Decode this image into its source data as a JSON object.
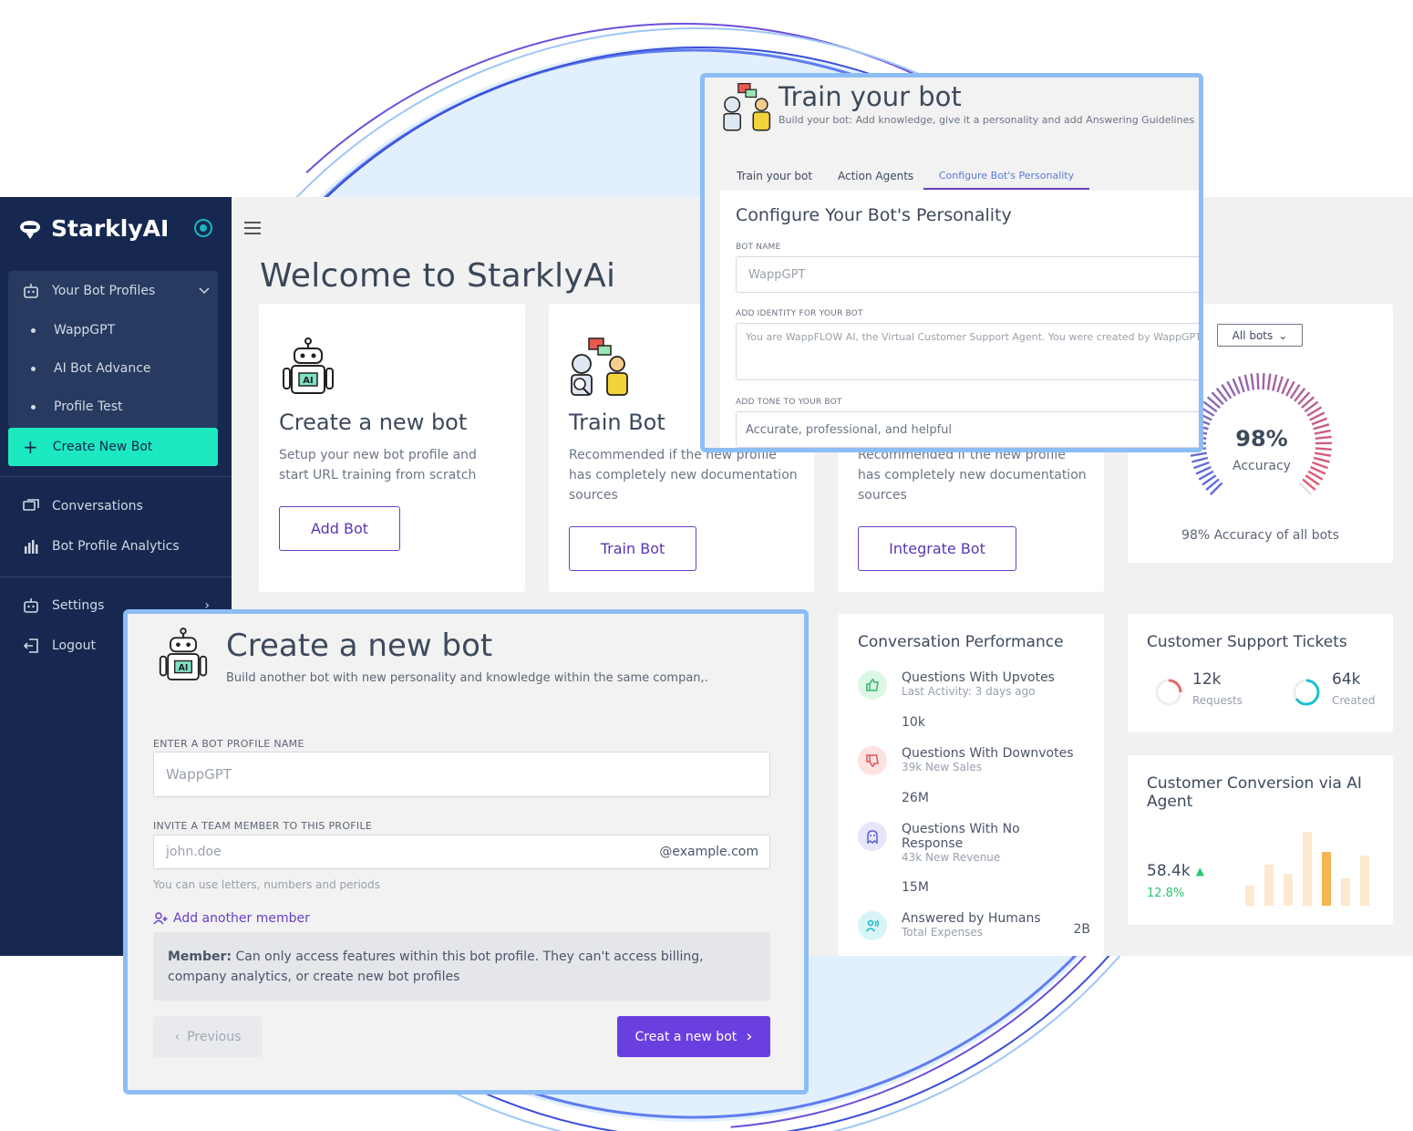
{
  "sidebar": {
    "brand": "StarklyAI",
    "group_label": "Your Bot Profiles",
    "bots": [
      "WappGPT",
      "AI Bot Advance",
      "Profile Test"
    ],
    "create_label": "Create New Bot",
    "nav": [
      "Conversations",
      "Bot Profile Analytics"
    ],
    "settings_label": "Settings",
    "logout_label": "Logout"
  },
  "main": {
    "welcome": "Welcome to StarklyAi",
    "cards": [
      {
        "title": "Create a new bot",
        "desc": "Setup your new bot profile and start URL training from scratch",
        "button": "Add Bot"
      },
      {
        "title": "Train Bot",
        "desc": "Recommended if the new profile has completely new documentation sources",
        "button": "Train Bot"
      },
      {
        "title": "",
        "desc": "Recommended if the new profile has completely new documentation sources",
        "button": "Integrate Bot"
      }
    ],
    "accuracy": {
      "filter": "All bots",
      "value_label": "98%",
      "value": 0.98,
      "label": "Accuracy",
      "caption": "98% Accuracy of all bots"
    },
    "performance": {
      "title": "Conversation Performance",
      "rows": [
        {
          "title": "Questions With Upvotes",
          "sub": "Last Activity: 3 days ago",
          "value": "10k",
          "icon": "thumbs-up-icon"
        },
        {
          "title": "Questions With Downvotes",
          "sub": "39k New Sales",
          "value": "26M",
          "icon": "thumbs-down-icon"
        },
        {
          "title": "Questions With No Response",
          "sub": "43k New Revenue",
          "value": "15M",
          "icon": "ghost-icon"
        },
        {
          "title": "Answered by Humans",
          "sub": "Total Expenses",
          "value": "2B",
          "icon": "users-icon"
        }
      ]
    },
    "tickets": {
      "title": "Customer Support Tickets",
      "requests_value": "12k",
      "requests_label": "Requests",
      "created_value": "64k",
      "created_label": "Created"
    },
    "conversion": {
      "title": "Customer Conversion via AI Agent",
      "value": "58.4k",
      "change": "12.8%"
    }
  },
  "train_panel": {
    "title": "Train your bot",
    "subtitle": "Build your bot: Add knowledge, give it a personality and add Answering Guidelines",
    "tabs": [
      "Train your bot",
      "Action Agents",
      "Configure Bot's Personality"
    ],
    "heading": "Configure Your Bot's Personality",
    "name_label": "BOT NAME",
    "name_value": "WappGPT",
    "identity_label": "ADD IDENTITY FOR YOUR BOT",
    "identity_value": "You are WappFLOW AI, the Virtual Customer Support Agent. You were created by WappGPT",
    "tone_label": "ADD TONE TO YOUR BOT",
    "tone_value": "Accurate, professional, and helpful"
  },
  "create_panel": {
    "title": "Create a new bot",
    "subtitle": "Build another bot with new personality and knowledge within the same compan,.",
    "profile_label": "ENTER A BOT PROFILE NAME",
    "profile_placeholder": "WappGPT",
    "invite_label": "INVITE A TEAM MEMBER TO THIS PROFILE",
    "invite_placeholder": "john.doe",
    "invite_suffix": "@example.com",
    "hint": "You can use letters, numbers and periods",
    "add_member": "Add another member",
    "note_bold": "Member:",
    "note_text": "Can only access features within this bot profile. They can't access billing, company analytics, or create new bot profiles",
    "prev": "Previous",
    "next": "Creat a new bot"
  },
  "colors": {
    "sidebar": "#16284f",
    "accent": "#1de9c0",
    "primary": "#6a3fc2",
    "panel_border": "#8dbdf5"
  }
}
